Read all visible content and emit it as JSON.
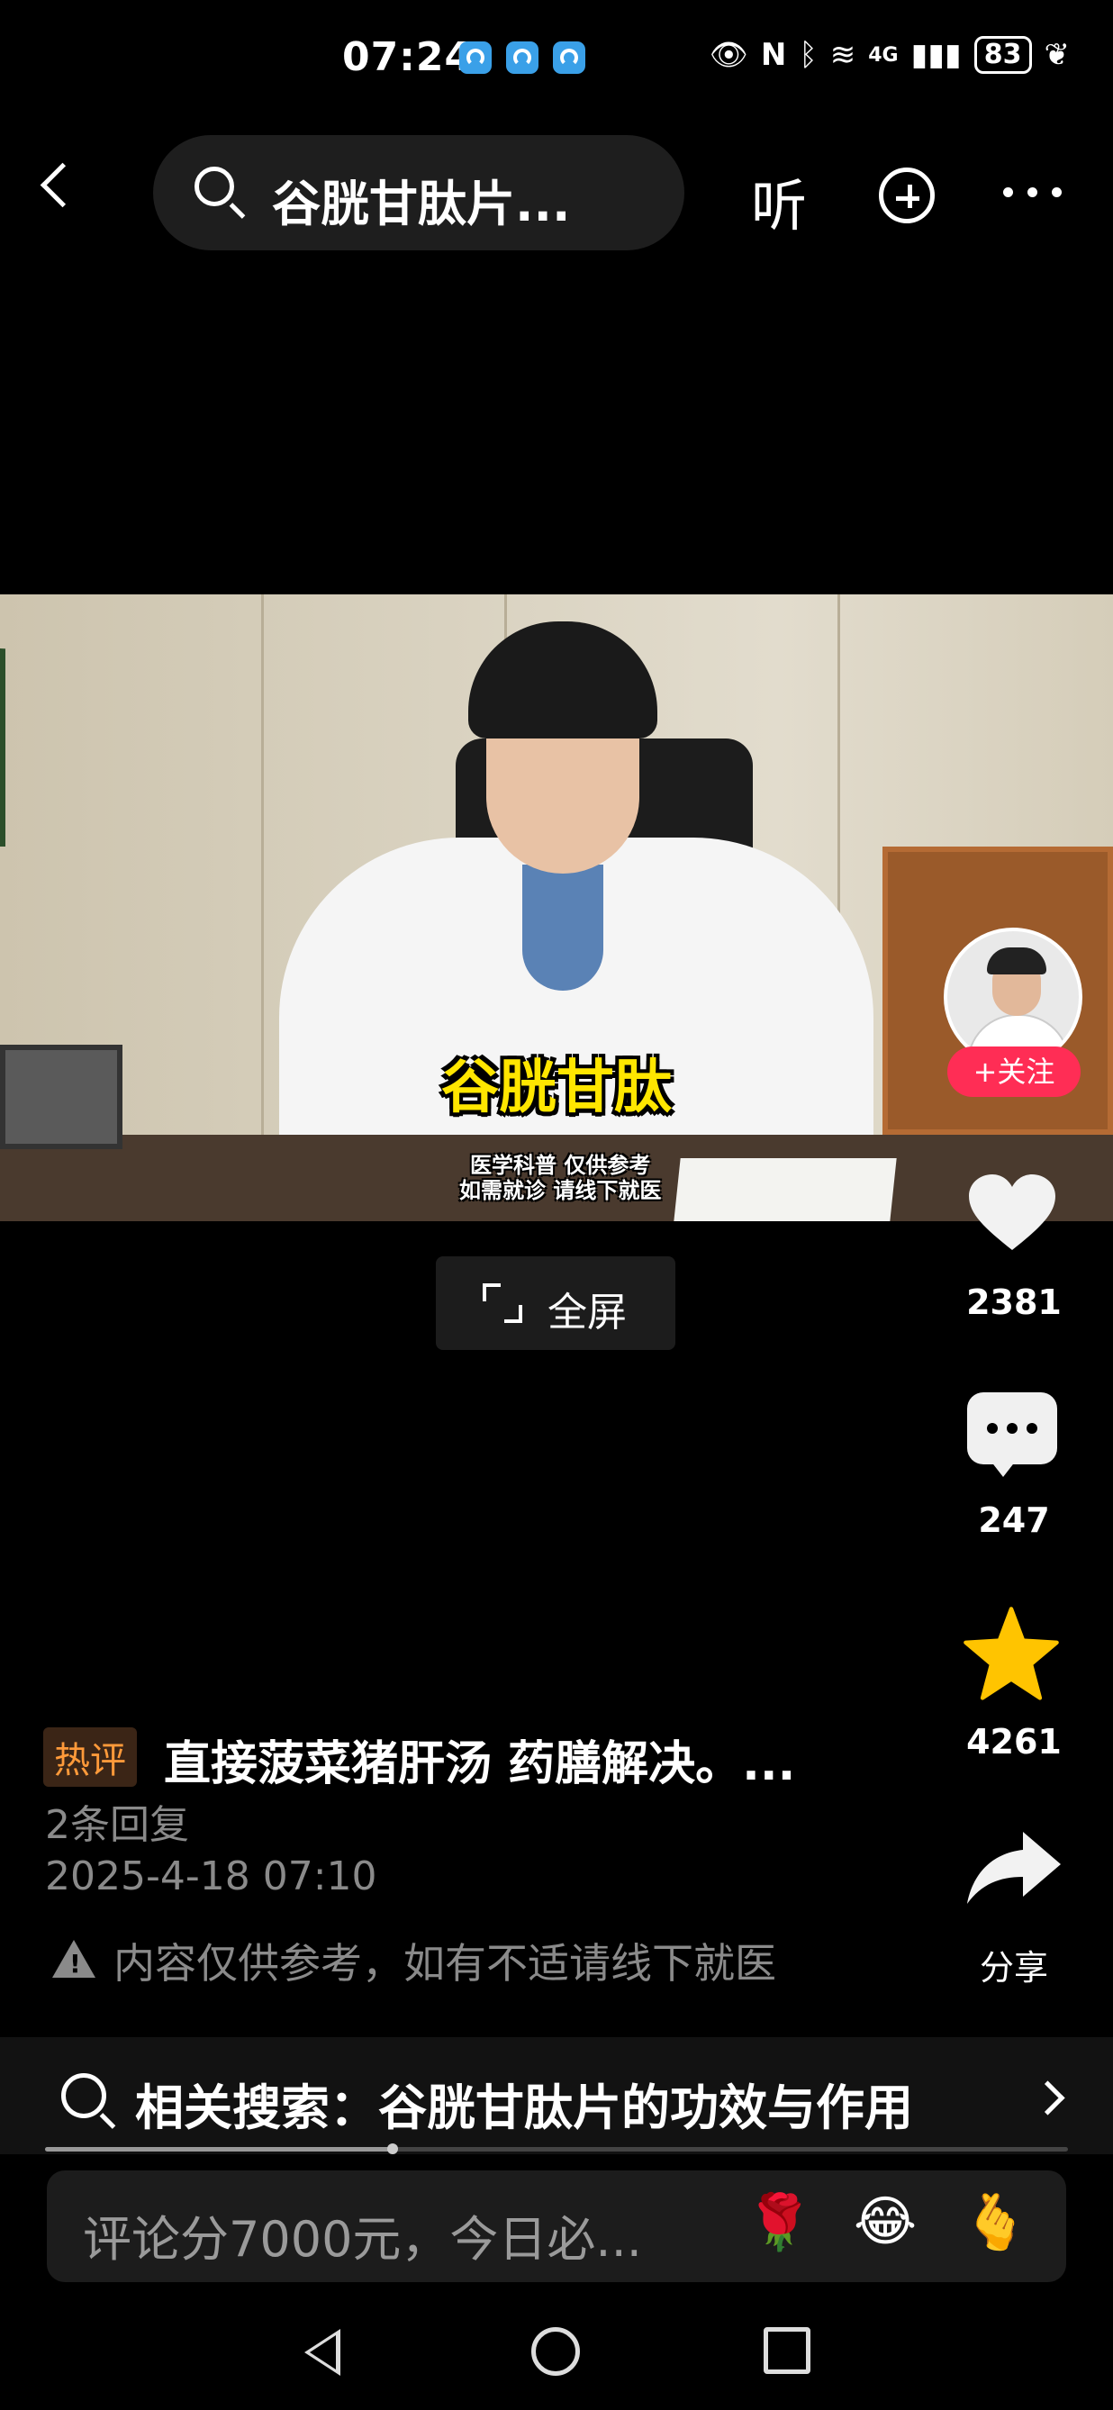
{
  "status_bar": {
    "time": "07:24",
    "network": "4G",
    "battery": "83"
  },
  "top_bar": {
    "search_text": "谷胱甘肽片...",
    "listen_label": "听"
  },
  "video": {
    "subtitle": "谷胱甘肽",
    "disclaimer_line1": "医学科普 仅供参考",
    "disclaimer_line2": "如需就诊 请线下就医",
    "fullscreen_label": "全屏"
  },
  "right_rail": {
    "follow_label": "+关注",
    "likes": "2381",
    "comments": "247",
    "favorites": "4261",
    "share_label": "分享"
  },
  "caption": {
    "hot_badge": "热评",
    "hot_comment": "直接菠菜猪肝汤 药膳解决。...",
    "replies": "2条回复",
    "date": "2025-4-18 07:10",
    "warning": "内容仅供参考，如有不适请线下就医"
  },
  "related": {
    "text": "相关搜索：谷胱甘肽片的功效与作用"
  },
  "progress": {
    "fraction": 0.34
  },
  "comment_bar": {
    "placeholder": "评论分7000元，今日必...",
    "emojis": [
      "🌹",
      "😂",
      "🫰"
    ]
  },
  "colors": {
    "follow": "#ff2d55",
    "star": "#ffc400",
    "subtitle": "#ffe600",
    "hot_badge": "#ff9a3a"
  }
}
